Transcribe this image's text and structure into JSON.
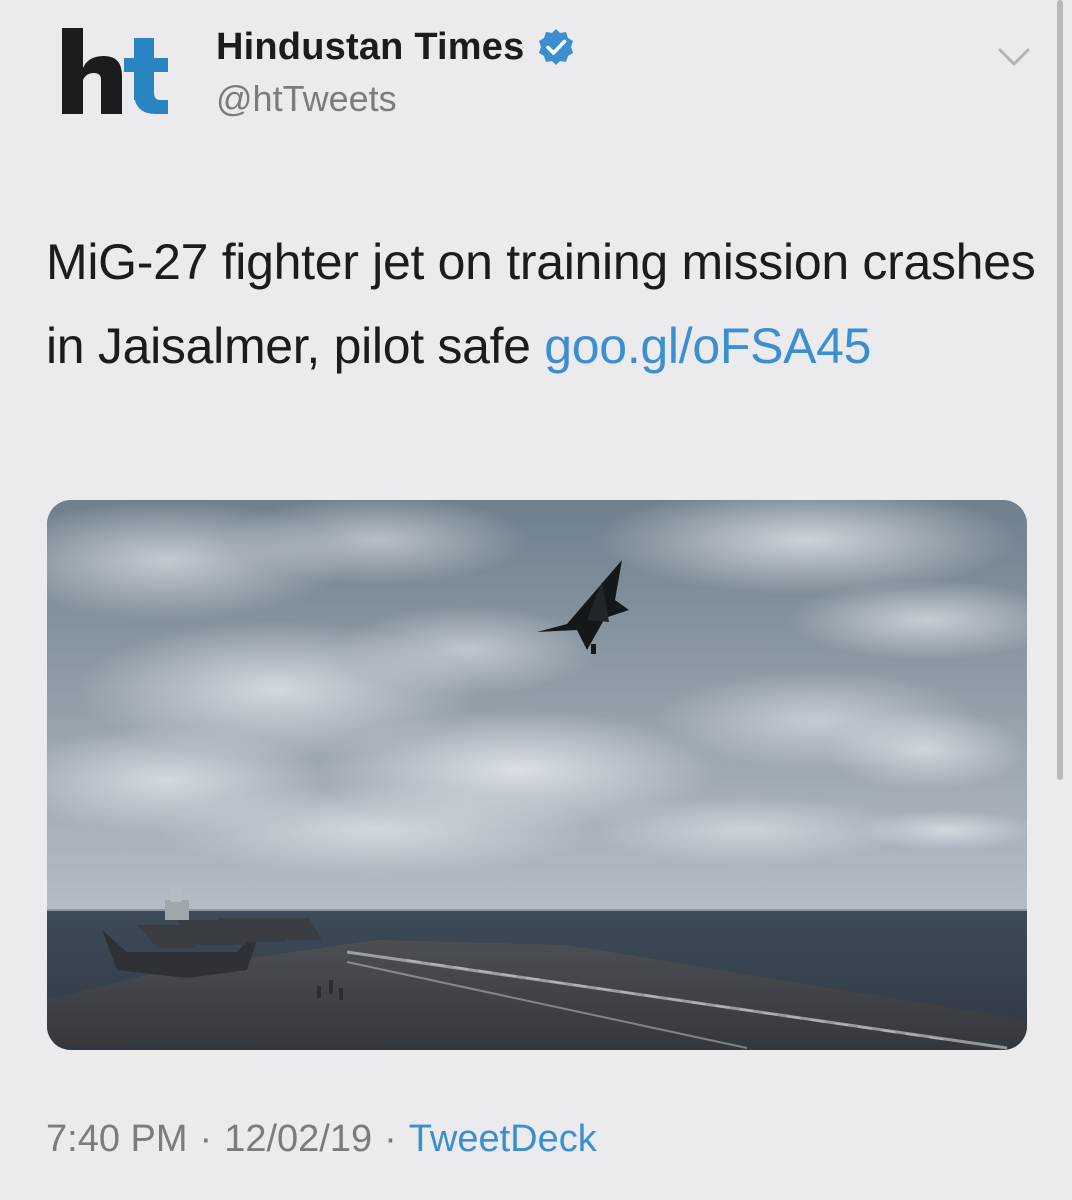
{
  "tweet": {
    "avatar_logo": "ht",
    "display_name": "Hindustan Times",
    "verified_icon": "verified-badge-icon",
    "handle": "@htTweets",
    "menu_icon": "chevron-down-icon",
    "text": "MiG-27 fighter jet on training mission crashes in Jaisalmer, pilot safe ",
    "link_text": "goo.gl/oFSA45",
    "media_image": "photo-fighter-jet-over-aircraft-carrier",
    "time": "7:40 PM",
    "separator": "·",
    "date": "12/02/19",
    "source": "TweetDeck"
  },
  "colors": {
    "background": "#ebebed",
    "link": "#3b8fd0",
    "verified": "#3b8fd0",
    "secondary_text": "#7b7b80",
    "brand_ht_h": "#1c1c1e",
    "brand_ht_t": "#2a86c2"
  }
}
